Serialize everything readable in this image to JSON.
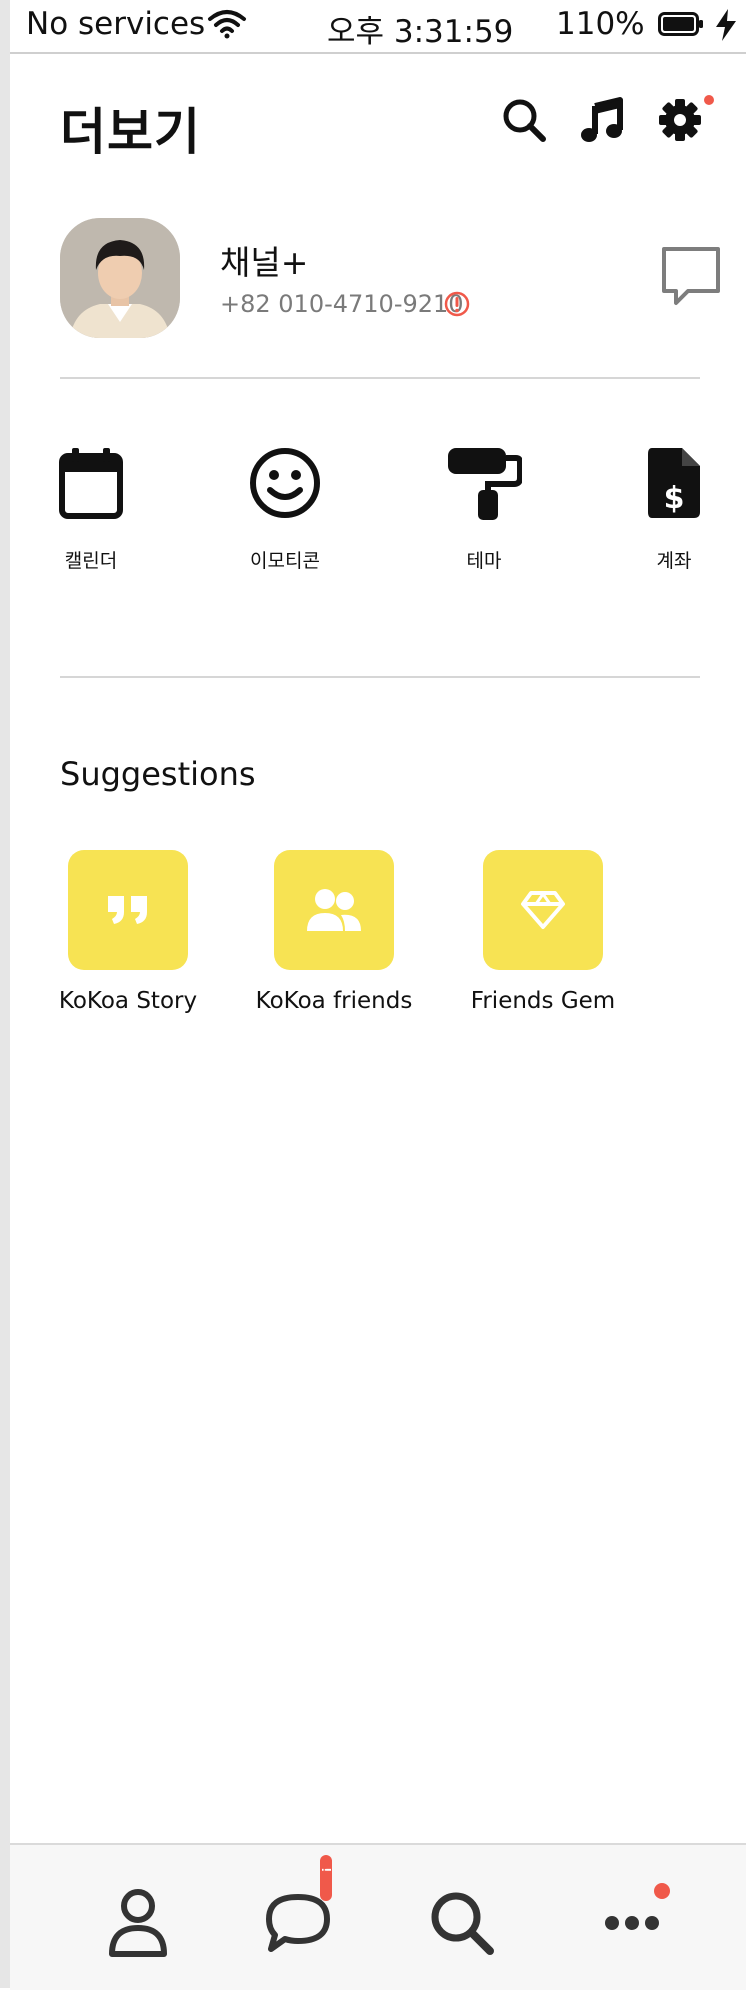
{
  "status_bar": {
    "carrier": "No services",
    "time": "오후 3:31:59",
    "battery_percent": "110%"
  },
  "header": {
    "title": "더보기",
    "icons": [
      "search-icon",
      "music-icon",
      "settings-icon"
    ],
    "settings_has_notification": true
  },
  "profile": {
    "name": "채널+",
    "phone": "+82 010-4710-9210",
    "warning_icon": "exclamation-circle-icon",
    "action_icon": "chat-bubble-icon"
  },
  "shortcuts": [
    {
      "label": "캘린더",
      "icon": "calendar-icon"
    },
    {
      "label": "이모티콘",
      "icon": "smiley-icon"
    },
    {
      "label": "테마",
      "icon": "paint-roller-icon"
    },
    {
      "label": "계좌",
      "icon": "dollar-document-icon"
    }
  ],
  "suggestions": {
    "title": "Suggestions",
    "items": [
      {
        "label": "KoKoa Story",
        "icon": "quote-icon"
      },
      {
        "label": "KoKoa friends",
        "icon": "users-icon"
      },
      {
        "label": "Friends Gem",
        "icon": "gem-icon"
      }
    ]
  },
  "bottom_nav": {
    "items": [
      "person-icon",
      "chat-icon",
      "search-icon",
      "more-icon"
    ],
    "chat_badge": "!!",
    "more_has_notification": true
  },
  "colors": {
    "accent_yellow": "#f7e353",
    "notification_red": "#f0594a",
    "text_secondary": "#7a7a7a"
  }
}
